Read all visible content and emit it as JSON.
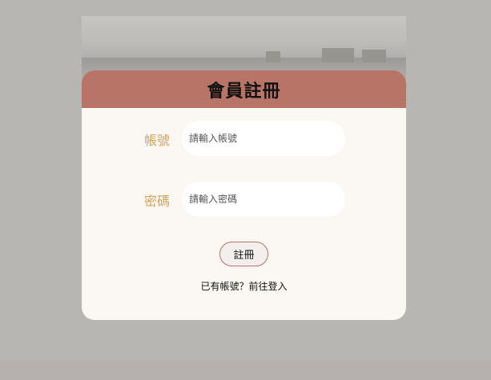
{
  "register_form": {
    "title": "會員註冊",
    "account": {
      "label": "帳號",
      "placeholder": "請輸入帳號",
      "value": ""
    },
    "password": {
      "label": "密碼",
      "placeholder": "請輸入密碼",
      "value": ""
    },
    "submit_label": "註冊",
    "login_prompt": "已有帳號？",
    "login_link_label": "前往登入"
  },
  "colors": {
    "page_background": "#b8b6b3",
    "header_background": "#b87466",
    "card_background": "#fbf7f2",
    "label_color": "#d1a55a",
    "button_border": "#b87466"
  }
}
